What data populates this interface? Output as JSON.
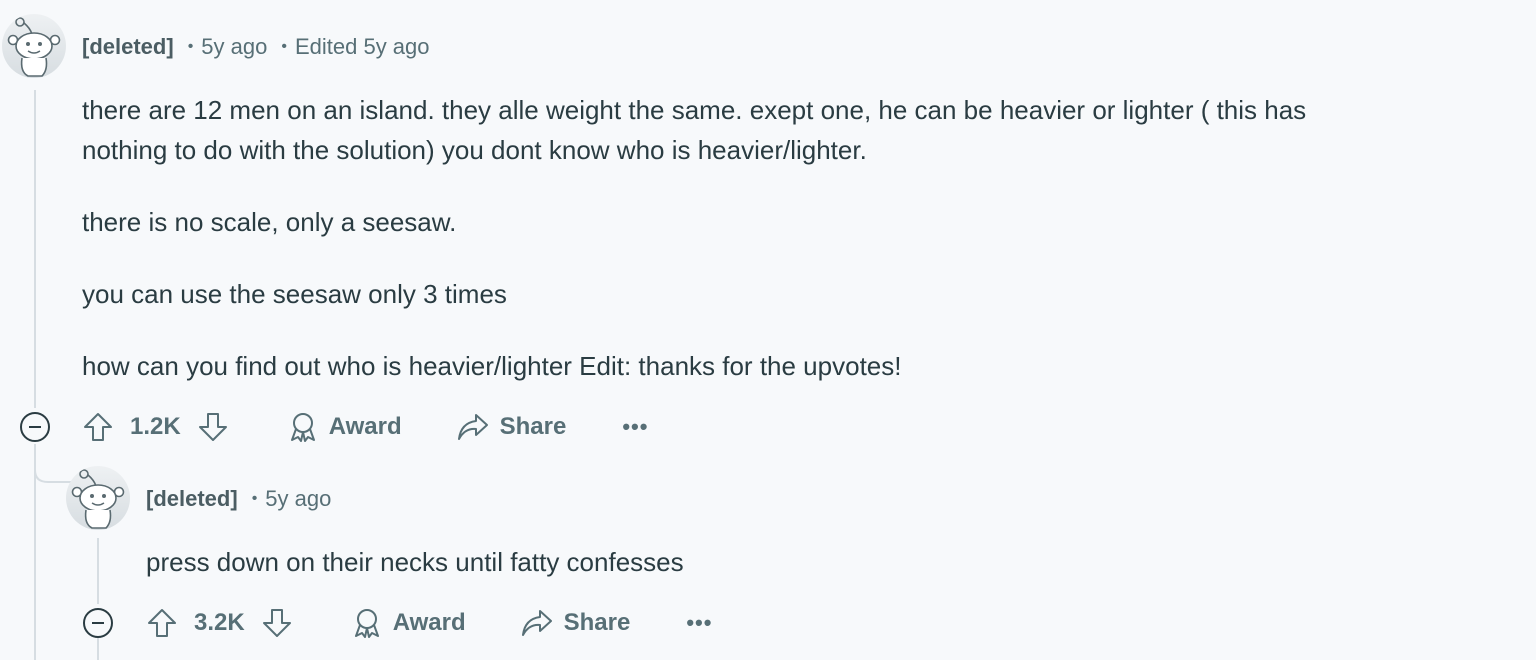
{
  "comments": [
    {
      "author": "[deleted]",
      "time": "5y ago",
      "edited": "Edited 5y ago",
      "paragraphs": [
        "there are 12 men on an island. they alle weight the same. exept one, he can be heavier or lighter ( this has",
        "nothing to do with the solution) you dont know who is heavier/lighter.",
        "there is no scale, only a seesaw.",
        "you can use the seesaw only 3 times",
        "how can you find out who is heavier/lighter Edit: thanks for the upvotes!"
      ],
      "votes": "1.2K",
      "award_label": "Award",
      "share_label": "Share",
      "more_label": "•••"
    },
    {
      "author": "[deleted]",
      "time": "5y ago",
      "paragraphs": [
        "press down on their necks until fatty confesses"
      ],
      "votes": "3.2K",
      "award_label": "Award",
      "share_label": "Share",
      "more_label": "•••"
    }
  ],
  "icons": {
    "avatar": "snoo-avatar-icon",
    "upvote": "arrow-up-icon",
    "downvote": "arrow-down-icon",
    "award": "award-icon",
    "share": "share-icon",
    "collapse": "collapse-icon",
    "more": "more-icon"
  }
}
